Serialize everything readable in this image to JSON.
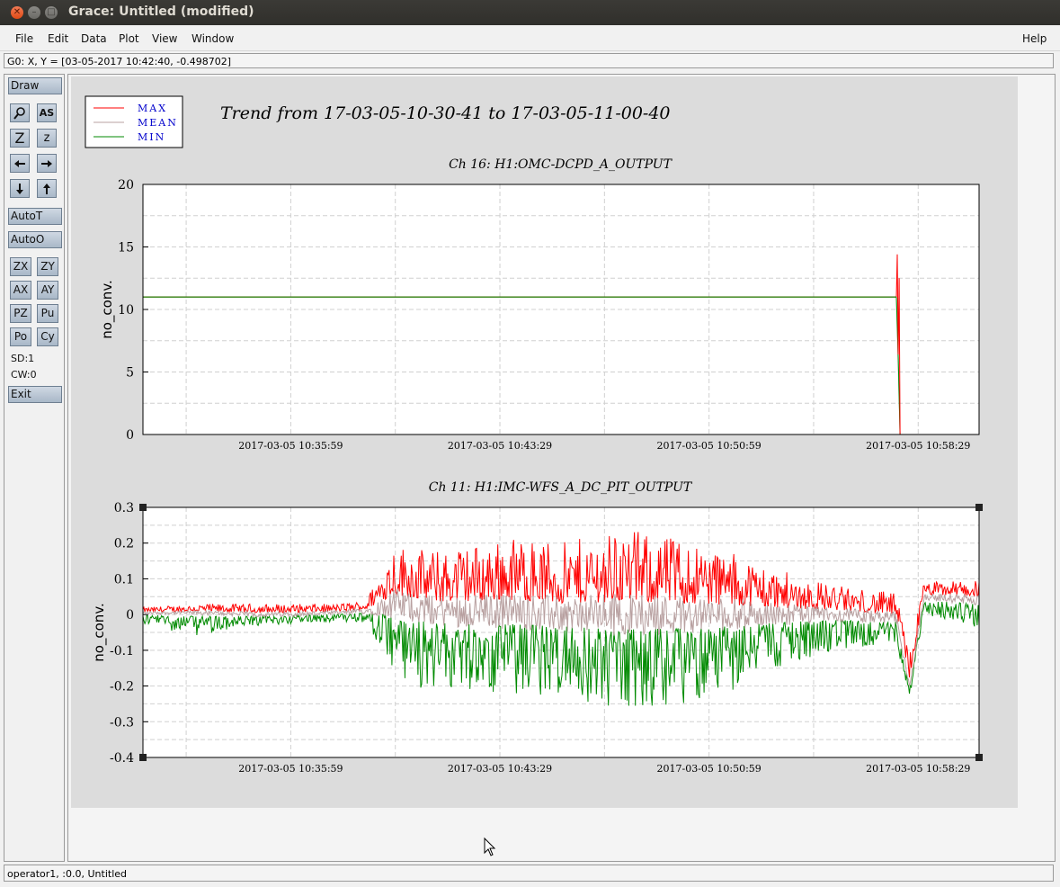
{
  "window": {
    "title": "Grace: Untitled (modified)"
  },
  "menu": {
    "file": "File",
    "edit": "Edit",
    "data": "Data",
    "plot": "Plot",
    "view": "View",
    "window": "Window",
    "help": "Help"
  },
  "locator": "G0: X, Y = [03-05-2017 10:42:40, -0.498702]",
  "toolbar": {
    "draw": "Draw",
    "as_icon": "AS",
    "zoom_z_big": "Z",
    "zoom_z_small": "z",
    "autot": "AutoT",
    "autoo": "AutoO",
    "zx": "ZX",
    "zy": "ZY",
    "ax": "AX",
    "ay": "AY",
    "pz": "PZ",
    "pu": "Pu",
    "po": "Po",
    "cy": "Cy",
    "sd": "SD:1",
    "cw": "CW:0",
    "exit": "Exit"
  },
  "status": "operator1, :0.0, Untitled",
  "colors": {
    "max": "#ff0000",
    "mean": "#b8a0a0",
    "min": "#008a00",
    "legend_text": "#0000cc",
    "button": "#b9c6d4"
  },
  "chart_data": [
    {
      "type": "line",
      "figure_title": "Trend from 17-03-05-10-30-41 to 17-03-05-11-00-40",
      "title": "Ch 16: H1:OMC-DCPD_A_OUTPUT",
      "xlabel": "",
      "ylabel": "no_conv.",
      "xlim": [
        "2017-03-05 10:30:41",
        "2017-03-05 11:00:40"
      ],
      "ylim": [
        0,
        20
      ],
      "yticks": [
        "0",
        "5",
        "10",
        "15",
        "20"
      ],
      "xticks": [
        "2017-03-05 10:35:59",
        "2017-03-05 10:43:29",
        "2017-03-05 10:50:59",
        "2017-03-05 10:58:29"
      ],
      "grid": true,
      "legend": "top-left",
      "series": [
        {
          "name": "MAX",
          "color": "#ff0000",
          "x": [
            "2017-03-05 10:30:41",
            "2017-03-05 10:57:42",
            "2017-03-05 10:57:44",
            "2017-03-05 10:57:46",
            "2017-03-05 10:57:48",
            "2017-03-05 10:57:50"
          ],
          "values": [
            11,
            11,
            14.4,
            6.4,
            12.5,
            0
          ]
        },
        {
          "name": "MEAN",
          "color": "#b8a0a0",
          "x": [
            "2017-03-05 10:30:41",
            "2017-03-05 10:57:42",
            "2017-03-05 10:57:50"
          ],
          "values": [
            11,
            11,
            0
          ]
        },
        {
          "name": "MIN",
          "color": "#008a00",
          "x": [
            "2017-03-05 10:30:41",
            "2017-03-05 10:57:42",
            "2017-03-05 10:57:46",
            "2017-03-05 10:57:50"
          ],
          "values": [
            11,
            11,
            6.2,
            0
          ]
        }
      ]
    },
    {
      "type": "line",
      "title": "Ch 11: H1:IMC-WFS_A_DC_PIT_OUTPUT",
      "xlabel": "",
      "ylabel": "no_conv.",
      "xlim": [
        "2017-03-05 10:30:41",
        "2017-03-05 11:00:40"
      ],
      "ylim": [
        -0.4,
        0.3
      ],
      "yticks": [
        "-0.4",
        "-0.3",
        "-0.2",
        "-0.1",
        "0",
        "0.1",
        "0.2",
        "0.3"
      ],
      "xticks": [
        "2017-03-05 10:35:59",
        "2017-03-05 10:43:29",
        "2017-03-05 10:50:59",
        "2017-03-05 10:58:29"
      ],
      "grid": true,
      "envelope": [
        {
          "x": "2017-03-05 10:30:41",
          "max": 0.02,
          "mean": 0.005,
          "min": -0.03
        },
        {
          "x": "2017-03-05 10:32:41",
          "max": 0.03,
          "mean": 0.005,
          "min": -0.06
        },
        {
          "x": "2017-03-05 10:35:11",
          "max": 0.03,
          "mean": 0.0,
          "min": -0.03
        },
        {
          "x": "2017-03-05 10:37:41",
          "max": 0.03,
          "mean": 0.005,
          "min": -0.02
        },
        {
          "x": "2017-03-05 10:38:41",
          "max": 0.04,
          "mean": 0.01,
          "min": -0.03
        },
        {
          "x": "2017-03-05 10:39:41",
          "max": 0.2,
          "mean": 0.03,
          "min": -0.18
        },
        {
          "x": "2017-03-05 10:41:11",
          "max": 0.18,
          "mean": 0.01,
          "min": -0.22
        },
        {
          "x": "2017-03-05 10:42:41",
          "max": 0.2,
          "mean": 0.01,
          "min": -0.22
        },
        {
          "x": "2017-03-05 10:44:11",
          "max": 0.22,
          "mean": 0.01,
          "min": -0.24
        },
        {
          "x": "2017-03-05 10:45:41",
          "max": 0.2,
          "mean": 0.0,
          "min": -0.22
        },
        {
          "x": "2017-03-05 10:47:41",
          "max": 0.24,
          "mean": 0.0,
          "min": -0.28
        },
        {
          "x": "2017-03-05 10:49:41",
          "max": 0.22,
          "mean": 0.0,
          "min": -0.26
        },
        {
          "x": "2017-03-05 10:51:41",
          "max": 0.18,
          "mean": 0.0,
          "min": -0.22
        },
        {
          "x": "2017-03-05 10:53:41",
          "max": 0.12,
          "mean": 0.0,
          "min": -0.14
        },
        {
          "x": "2017-03-05 10:55:41",
          "max": 0.08,
          "mean": 0.0,
          "min": -0.1
        },
        {
          "x": "2017-03-05 10:57:41",
          "max": 0.06,
          "mean": -0.01,
          "min": -0.08
        },
        {
          "x": "2017-03-05 10:58:11",
          "max": -0.1,
          "mean": -0.2,
          "min": -0.23
        },
        {
          "x": "2017-03-05 10:58:41",
          "max": 0.09,
          "mean": 0.05,
          "min": 0.0
        },
        {
          "x": "2017-03-05 11:00:40",
          "max": 0.1,
          "mean": 0.04,
          "min": -0.04
        }
      ],
      "series": [
        {
          "name": "MAX",
          "color": "#ff0000"
        },
        {
          "name": "MEAN",
          "color": "#b8a0a0"
        },
        {
          "name": "MIN",
          "color": "#008a00"
        }
      ]
    }
  ]
}
